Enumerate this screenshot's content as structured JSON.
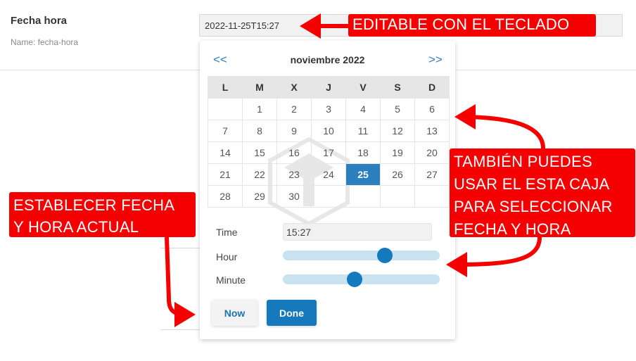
{
  "field": {
    "label": "Fecha hora",
    "name_hint": "Name: fecha-hora",
    "value": "2022-11-25T15:27"
  },
  "calendar": {
    "prev_nav": "<<",
    "next_nav": ">>",
    "month_title": "noviembre 2022",
    "weekdays": [
      "L",
      "M",
      "X",
      "J",
      "V",
      "S",
      "D"
    ],
    "weeks": [
      [
        "",
        "1",
        "2",
        "3",
        "4",
        "5",
        "6"
      ],
      [
        "7",
        "8",
        "9",
        "10",
        "11",
        "12",
        "13"
      ],
      [
        "14",
        "15",
        "16",
        "17",
        "18",
        "19",
        "20"
      ],
      [
        "21",
        "22",
        "23",
        "24",
        "25",
        "26",
        "27"
      ],
      [
        "28",
        "29",
        "30",
        "",
        "",
        "",
        ""
      ]
    ],
    "selected_day": "25"
  },
  "time": {
    "time_label": "Time",
    "time_value": "15:27",
    "hour_label": "Hour",
    "hour_value": 15,
    "hour_max": 23,
    "minute_label": "Minute",
    "minute_value": 27,
    "minute_max": 59
  },
  "buttons": {
    "now_label": "Now",
    "done_label": "Done"
  },
  "annotations": {
    "editable": "EDITABLE CON EL TECLADO",
    "box_use": "TAMBIÉN PUEDES\nUSAR EL ESTA CAJA\nPARA SELECCIONAR\nFECHA Y HORA",
    "set_now": "ESTABLECER FECHA\nY HORA ACTUAL"
  },
  "colors": {
    "accent": "#1779bd",
    "selected_day": "#2a7fbc",
    "slider_track": "#c9e2f0",
    "annotation_red": "#f50000"
  }
}
